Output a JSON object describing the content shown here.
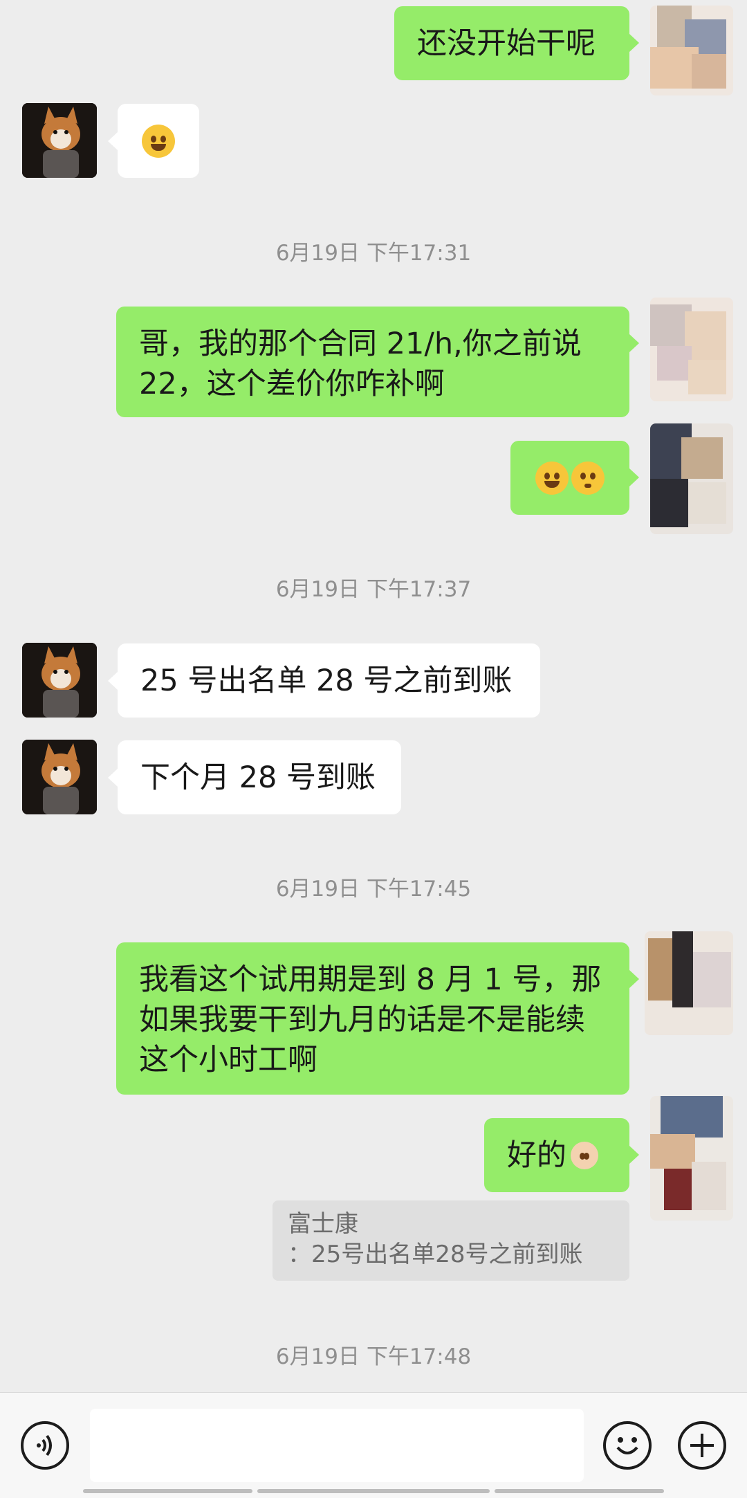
{
  "messages": {
    "m1": "还没开始干呢",
    "t1": "6月19日 下午17:31",
    "m3": [
      "哥，我的那个合同 21/h,你之前说",
      "22，这个差价你咋补啊"
    ],
    "t2": "6月19日 下午17:37",
    "m5": "25 号出名单 28 号之前到账",
    "m6": "下个月 28 号到账",
    "t3": "6月19日 下午17:45",
    "m7": [
      "我看这个试用期是到 8 月 1 号，那",
      "如果我要干到九月的话是不是能续",
      "这个小时工啊"
    ],
    "m8": "好的",
    "quote_name": "富士康",
    "quote_text": "：25号出名单28号之前到账",
    "t4": "6月19日 下午17:48"
  },
  "emojis": {
    "m2": "facepalm-emoji",
    "m4a": "tears-of-joy-emoji",
    "m4b": "flushed-emoji",
    "m8": "ok-hand-emoji"
  },
  "icons": {
    "voice": "voice-icon",
    "emoji": "emoji-icon",
    "plus": "plus-icon"
  },
  "colors": {
    "my_bubble": "#95ec69",
    "other_bubble": "#ffffff",
    "background": "#ededed"
  }
}
